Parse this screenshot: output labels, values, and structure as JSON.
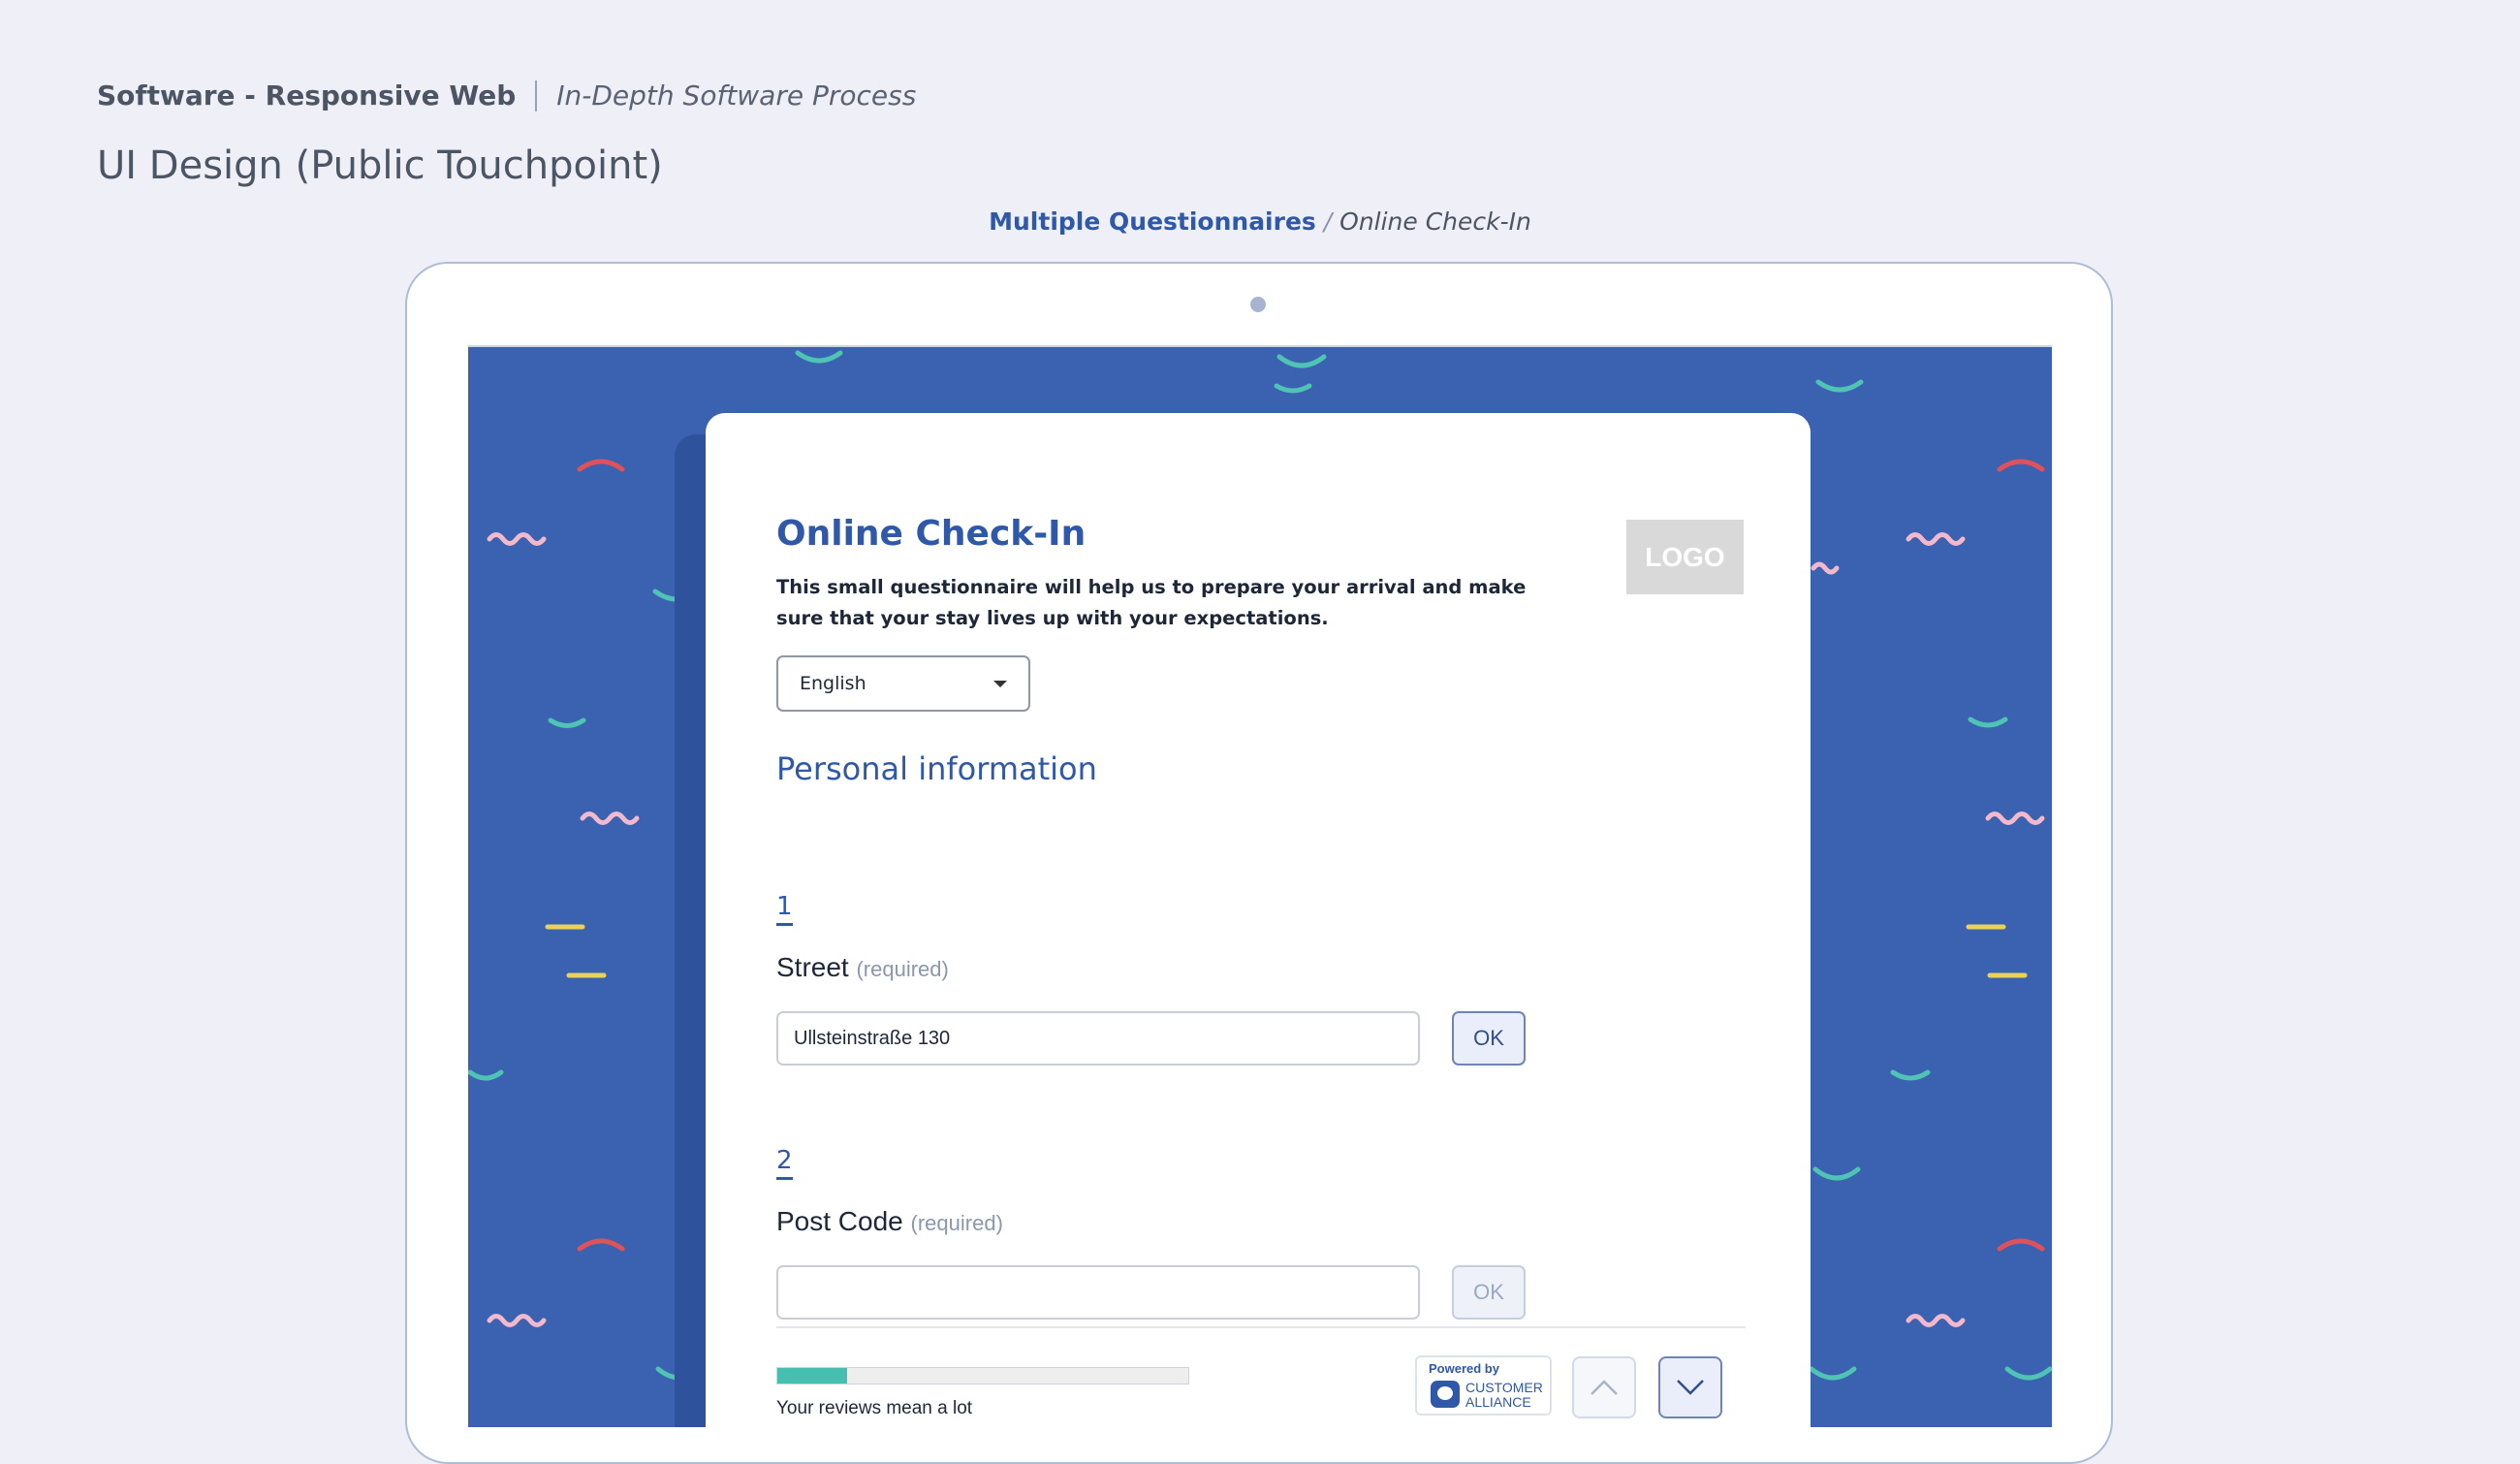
{
  "header": {
    "product": "Software - Responsive Web",
    "process": "In-Depth Software Process",
    "title": "UI Design (Public Touchpoint)"
  },
  "breadcrumb": {
    "link": "Multiple Questionnaires",
    "separator": "/",
    "current": "Online Check-In"
  },
  "checkin": {
    "title": "Online Check-In",
    "intro": "This small questionnaire will help us to prepare your arrival and make sure that your stay lives up with your expectations.",
    "logo": "LOGO",
    "language": "English",
    "section": "Personal information",
    "questions": [
      {
        "number": "1",
        "label": "Street",
        "required": "(required)",
        "value": "Ullsteinstraße 130",
        "ok": "OK"
      },
      {
        "number": "2",
        "label": "Post Code",
        "required": "(required)",
        "value": "",
        "ok": "OK"
      }
    ],
    "progress": {
      "percent": 17,
      "label": "Your reviews mean a lot"
    },
    "powered": {
      "by": "Powered by",
      "name_line1": "CUSTOMER",
      "name_line2": "ALLIANCE"
    }
  },
  "colors": {
    "accent": "#2f58a8",
    "screen_bg": "#3a62b1",
    "progress_fill": "#47bfb0",
    "deco_teal": "#4fc4b5",
    "deco_red": "#e0525a",
    "deco_pink": "#f2b8cc",
    "deco_yellow": "#e8d35a"
  }
}
